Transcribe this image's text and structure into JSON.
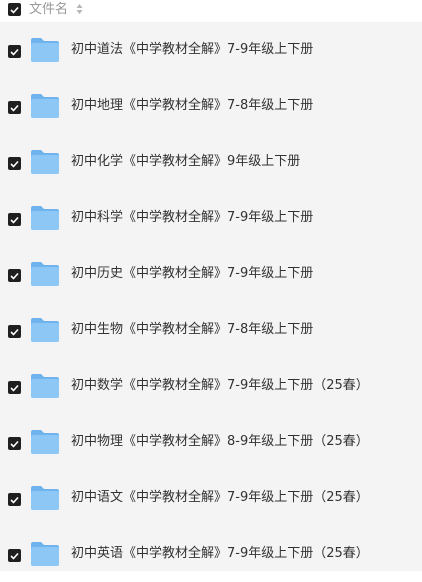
{
  "header": {
    "column_label": "文件名",
    "select_all_checked": true
  },
  "colors": {
    "folder_body": "#8cc7f5",
    "folder_tab": "#6fb3ee",
    "checkbox": "#1f1f1f",
    "row_background": "#f4f4f4"
  },
  "files": [
    {
      "name": "初中道法《中学教材全解》7-9年级上下册",
      "type": "folder",
      "checked": true
    },
    {
      "name": "初中地理《中学教材全解》7-8年级上下册",
      "type": "folder",
      "checked": true
    },
    {
      "name": "初中化学《中学教材全解》9年级上下册",
      "type": "folder",
      "checked": true
    },
    {
      "name": "初中科学《中学教材全解》7-9年级上下册",
      "type": "folder",
      "checked": true
    },
    {
      "name": "初中历史《中学教材全解》7-9年级上下册",
      "type": "folder",
      "checked": true
    },
    {
      "name": "初中生物《中学教材全解》7-8年级上下册",
      "type": "folder",
      "checked": true
    },
    {
      "name": "初中数学《中学教材全解》7-9年级上下册（25春）",
      "type": "folder",
      "checked": true
    },
    {
      "name": "初中物理《中学教材全解》8-9年级上下册（25春）",
      "type": "folder",
      "checked": true
    },
    {
      "name": "初中语文《中学教材全解》7-9年级上下册（25春）",
      "type": "folder",
      "checked": true
    },
    {
      "name": "初中英语《中学教材全解》7-9年级上下册（25春）",
      "type": "folder",
      "checked": true
    }
  ]
}
